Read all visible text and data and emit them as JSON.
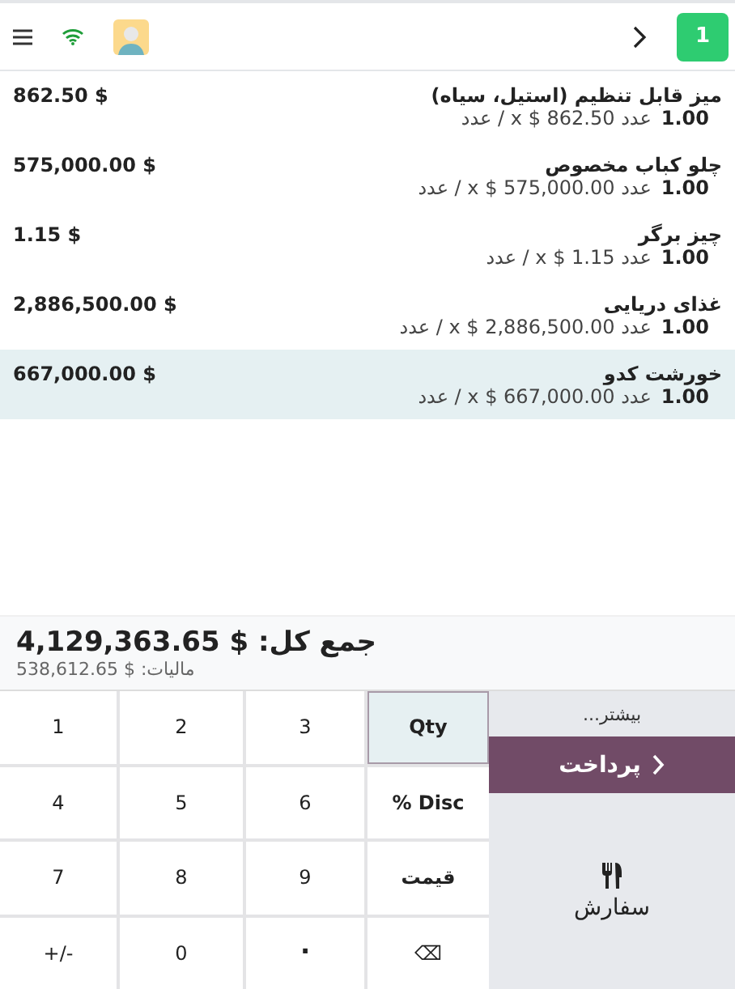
{
  "header": {
    "order_count": "1"
  },
  "order_lines": [
    {
      "name": "میز قابل تنظیم (استیل، سیاه)",
      "quantity": "1.00",
      "detail": "عدد 862.50 $ x / عدد",
      "amount": "862.50 $",
      "selected": false
    },
    {
      "name": "چلو کباب مخصوص",
      "quantity": "1.00",
      "detail": "عدد 575,000.00 $ x / عدد",
      "amount": "575,000.00 $",
      "selected": false
    },
    {
      "name": "چیز برگر",
      "quantity": "1.00",
      "detail": "عدد 1.15 $ x / عدد",
      "amount": "1.15 $",
      "selected": false
    },
    {
      "name": "غذای دریایی",
      "quantity": "1.00",
      "detail": "عدد 2,886,500.00 $ x / عدد",
      "amount": "2,886,500.00 $",
      "selected": false
    },
    {
      "name": "خورشت کدو",
      "quantity": "1.00",
      "detail": "عدد 667,000.00 $ x / عدد",
      "amount": "667,000.00 $",
      "selected": true
    }
  ],
  "summary": {
    "total": "جمع کل: $ 4,129,363.65",
    "tax": "مالیات: $ 538,612.65"
  },
  "keypad": [
    {
      "label": "Qty",
      "kind": "mode",
      "selected": true
    },
    {
      "label": "3",
      "kind": "digit"
    },
    {
      "label": "2",
      "kind": "digit"
    },
    {
      "label": "1",
      "kind": "digit"
    },
    {
      "label": "% Disc",
      "kind": "mode",
      "selected": false
    },
    {
      "label": "6",
      "kind": "digit"
    },
    {
      "label": "5",
      "kind": "digit"
    },
    {
      "label": "4",
      "kind": "digit"
    },
    {
      "label": "قیمت",
      "kind": "mode",
      "selected": false
    },
    {
      "label": "9",
      "kind": "digit"
    },
    {
      "label": "8",
      "kind": "digit"
    },
    {
      "label": "7",
      "kind": "digit"
    },
    {
      "label": "⌫",
      "kind": "digit"
    },
    {
      "label": ".",
      "kind": "point"
    },
    {
      "label": "0",
      "kind": "digit"
    },
    {
      "label": "+/-",
      "kind": "digit"
    }
  ],
  "actions": {
    "more": "بیشتر...",
    "payment": "پرداخت",
    "order": "سفارش"
  }
}
